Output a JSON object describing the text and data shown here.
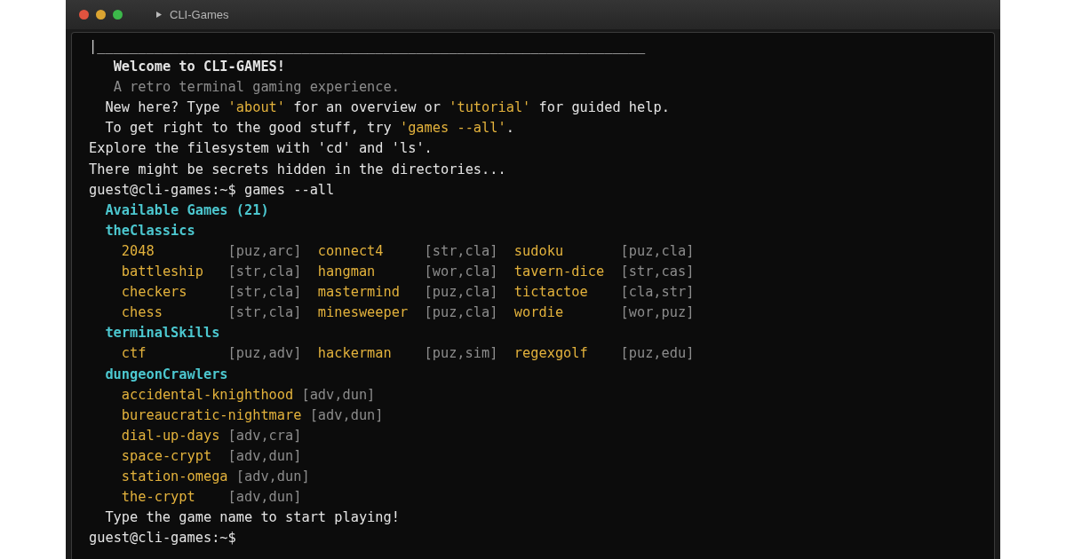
{
  "window": {
    "title": "CLI-Games"
  },
  "lines": [
    {
      "kind": "rule",
      "text": "|___________________________________________________________________"
    },
    {
      "kind": "title",
      "text": "Welcome to CLI-GAMES!"
    },
    {
      "kind": "subtitle",
      "text": "A retro terminal gaming experience."
    },
    {
      "kind": "hint",
      "segments": [
        {
          "text": "New here? Type ",
          "highlight": false
        },
        {
          "text": "'about'",
          "highlight": true
        },
        {
          "text": " for an overview or ",
          "highlight": false
        },
        {
          "text": "'tutorial'",
          "highlight": true
        },
        {
          "text": " for guided help.",
          "highlight": false
        }
      ]
    },
    {
      "kind": "hint",
      "segments": [
        {
          "text": "To get right to the good stuff, try ",
          "highlight": false
        },
        {
          "text": "'games --all'",
          "highlight": true
        },
        {
          "text": ".",
          "highlight": false
        }
      ]
    },
    {
      "kind": "text",
      "text": "Explore the filesystem with 'cd' and 'ls'."
    },
    {
      "kind": "text",
      "text": "There might be secrets hidden in the directories..."
    },
    {
      "kind": "prompt",
      "prompt": "guest@cli-games:~$",
      "command": "games --all"
    },
    {
      "kind": "section",
      "text": "Available Games (21)"
    },
    {
      "kind": "section",
      "text": "theClassics"
    },
    {
      "kind": "games",
      "games": [
        {
          "name": "2048",
          "tags": "[puz,arc]"
        },
        {
          "name": "connect4",
          "tags": "[str,cla]"
        },
        {
          "name": "sudoku",
          "tags": "[puz,cla]"
        }
      ]
    },
    {
      "kind": "games",
      "games": [
        {
          "name": "battleship",
          "tags": "[str,cla]"
        },
        {
          "name": "hangman",
          "tags": "[wor,cla]"
        },
        {
          "name": "tavern-dice",
          "tags": "[str,cas]"
        }
      ]
    },
    {
      "kind": "games",
      "games": [
        {
          "name": "checkers",
          "tags": "[str,cla]"
        },
        {
          "name": "mastermind",
          "tags": "[puz,cla]"
        },
        {
          "name": "tictactoe",
          "tags": "[cla,str]"
        }
      ]
    },
    {
      "kind": "games",
      "games": [
        {
          "name": "chess",
          "tags": "[str,cla]"
        },
        {
          "name": "minesweeper",
          "tags": "[puz,cla]"
        },
        {
          "name": "wordie",
          "tags": "[wor,puz]"
        }
      ]
    },
    {
      "kind": "section",
      "text": "terminalSkills"
    },
    {
      "kind": "games",
      "games": [
        {
          "name": "ctf",
          "tags": "[puz,adv]"
        },
        {
          "name": "hackerman",
          "tags": "[puz,sim]"
        },
        {
          "name": "regexgolf",
          "tags": "[puz,edu]"
        }
      ]
    },
    {
      "kind": "section",
      "text": "dungeonCrawlers"
    },
    {
      "kind": "games",
      "games": [
        {
          "name": "accidental-knighthood",
          "tags": "[adv,dun]"
        }
      ]
    },
    {
      "kind": "games",
      "games": [
        {
          "name": "bureaucratic-nightmare",
          "tags": "[adv,dun]"
        }
      ]
    },
    {
      "kind": "games",
      "games": [
        {
          "name": "dial-up-days",
          "tags": "[adv,cra]"
        }
      ]
    },
    {
      "kind": "games",
      "games": [
        {
          "name": "space-crypt",
          "tags": "[adv,dun]"
        }
      ]
    },
    {
      "kind": "games",
      "games": [
        {
          "name": "station-omega",
          "tags": "[adv,dun]"
        }
      ]
    },
    {
      "kind": "games",
      "games": [
        {
          "name": "the-crypt",
          "tags": "[adv,dun]"
        }
      ]
    },
    {
      "kind": "note",
      "text": "Type the game name to start playing!"
    },
    {
      "kind": "prompt",
      "prompt": "guest@cli-games:~$"
    }
  ]
}
